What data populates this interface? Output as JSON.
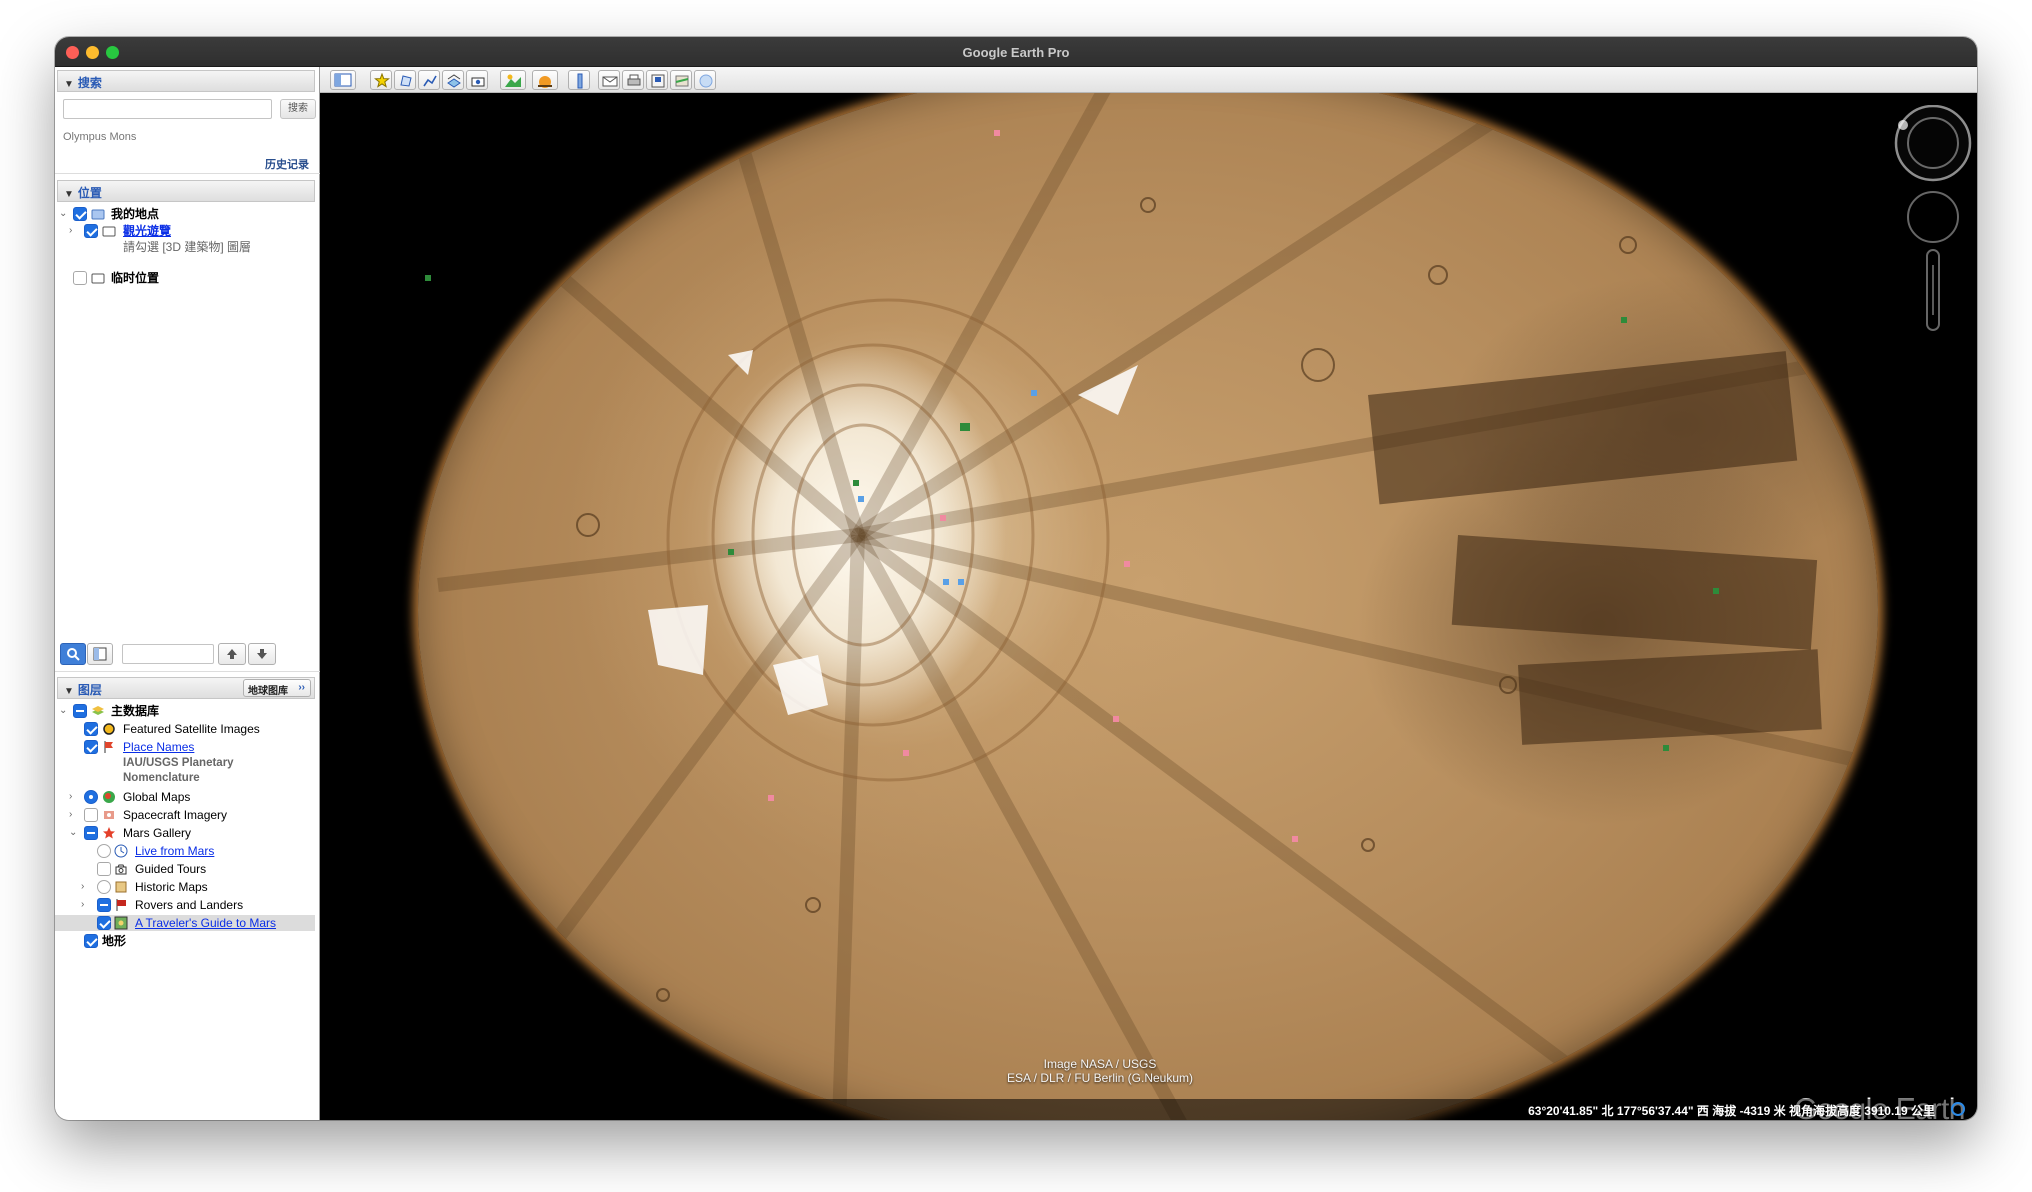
{
  "window": {
    "title": "Google Earth Pro"
  },
  "search": {
    "title": "搜索",
    "placeholder": "",
    "button": "搜索",
    "history_item": "Olympus Mons",
    "history_link": "历史记录"
  },
  "places": {
    "title": "位置",
    "items": [
      {
        "label": "我的地点",
        "checked": true
      },
      {
        "label": "觀光遊覽",
        "checked": true,
        "link": true,
        "note": "請勾選 [3D 建築物] 圖層"
      },
      {
        "label": "临时位置",
        "checked": false
      }
    ]
  },
  "tour_controls": {
    "value": ""
  },
  "layers": {
    "title": "图层",
    "gallery_button": "地球图库",
    "items": [
      {
        "label": "主数据库"
      },
      {
        "label": "Featured Satellite Images"
      },
      {
        "label": "Place Names",
        "sub1": "IAU/USGS Planetary",
        "sub2": "Nomenclature"
      },
      {
        "label": "Global Maps"
      },
      {
        "label": "Spacecraft Imagery"
      },
      {
        "label": "Mars Gallery"
      },
      {
        "label": "Live from Mars"
      },
      {
        "label": "Guided Tours"
      },
      {
        "label": "Historic Maps"
      },
      {
        "label": "Rovers and Landers"
      },
      {
        "label": "A Traveler's Guide to Mars"
      },
      {
        "label": "地形"
      }
    ]
  },
  "toolbar": {
    "buttons": [
      "sidebar-toggle",
      "add-placemark",
      "add-polygon",
      "add-path",
      "add-image-overlay",
      "record-tour",
      "historical-imagery",
      "sunlight",
      "switch-planet",
      "ruler",
      "email",
      "print",
      "save-image",
      "view-in-maps",
      "switch-globe"
    ]
  },
  "map": {
    "attribution_line1": "Image NASA / USGS",
    "attribution_line2": "ESA / DLR / FU Berlin (G.Neukum)",
    "logo": "Google Earth",
    "status": "63°20'41.85\" 北   177°56'37.44\" 西   海拔 -4319 米      视角海拔高度 3910.19 公里"
  },
  "colors": {
    "accent": "#1f6fe0",
    "link": "#0a2ee6",
    "panel_header": "#2a5bb5",
    "planet": "#b68d5d"
  }
}
